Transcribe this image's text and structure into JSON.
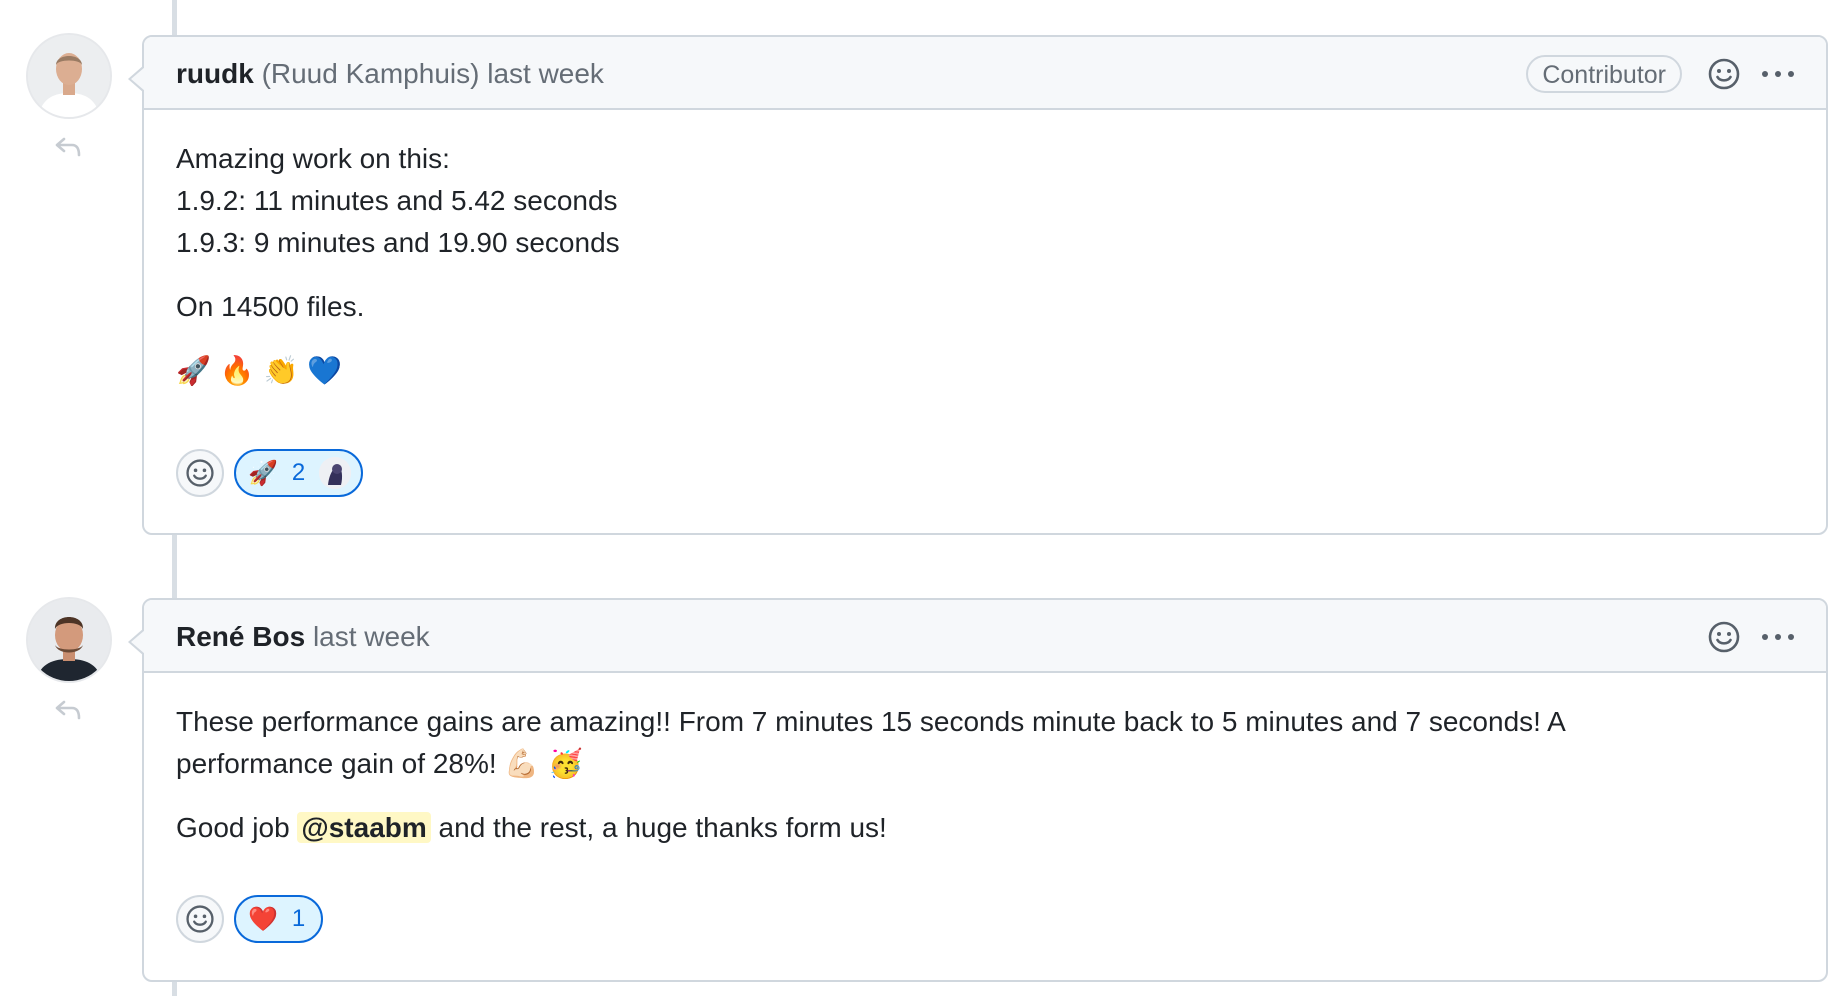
{
  "comments": [
    {
      "author": "ruudk",
      "full_name": "(Ruud Kamphuis)",
      "time": "last week",
      "badge": "Contributor",
      "body": {
        "line1": "Amazing work on this:",
        "line2": "1.9.2: 11 minutes and 5.42 seconds",
        "line3": "1.9.3: 9 minutes and 19.90 seconds",
        "para2": "On 14500 files.",
        "emojis": "🚀 🔥 👏 💙"
      },
      "reaction": {
        "emoji": "🚀",
        "count": "2"
      }
    },
    {
      "author": "René Bos",
      "time": "last week",
      "body": {
        "para1_line1": "These performance gains are amazing!! From 7 minutes 15 seconds minute back to 5 minutes and 7 seconds! A",
        "para1_line2": "performance gain of 28%!",
        "para1_emojis": "💪🏻 🥳",
        "para2_start": "Good job",
        "mention": "@staabm",
        "para2_end": "and the rest, a huge thanks form us!"
      },
      "reaction": {
        "emoji": "❤️",
        "count": "1"
      }
    }
  ],
  "icons": {
    "add_reaction": "smiley-icon",
    "more": "kebab-horizontal-icon",
    "reply": "reply-arrow-icon"
  },
  "colors": {
    "accent": "#0969da",
    "reaction_bg": "#ddf4ff",
    "mention_bg": "#fff8c5",
    "header_bg": "#f6f8fa",
    "border": "#d0d7de"
  }
}
